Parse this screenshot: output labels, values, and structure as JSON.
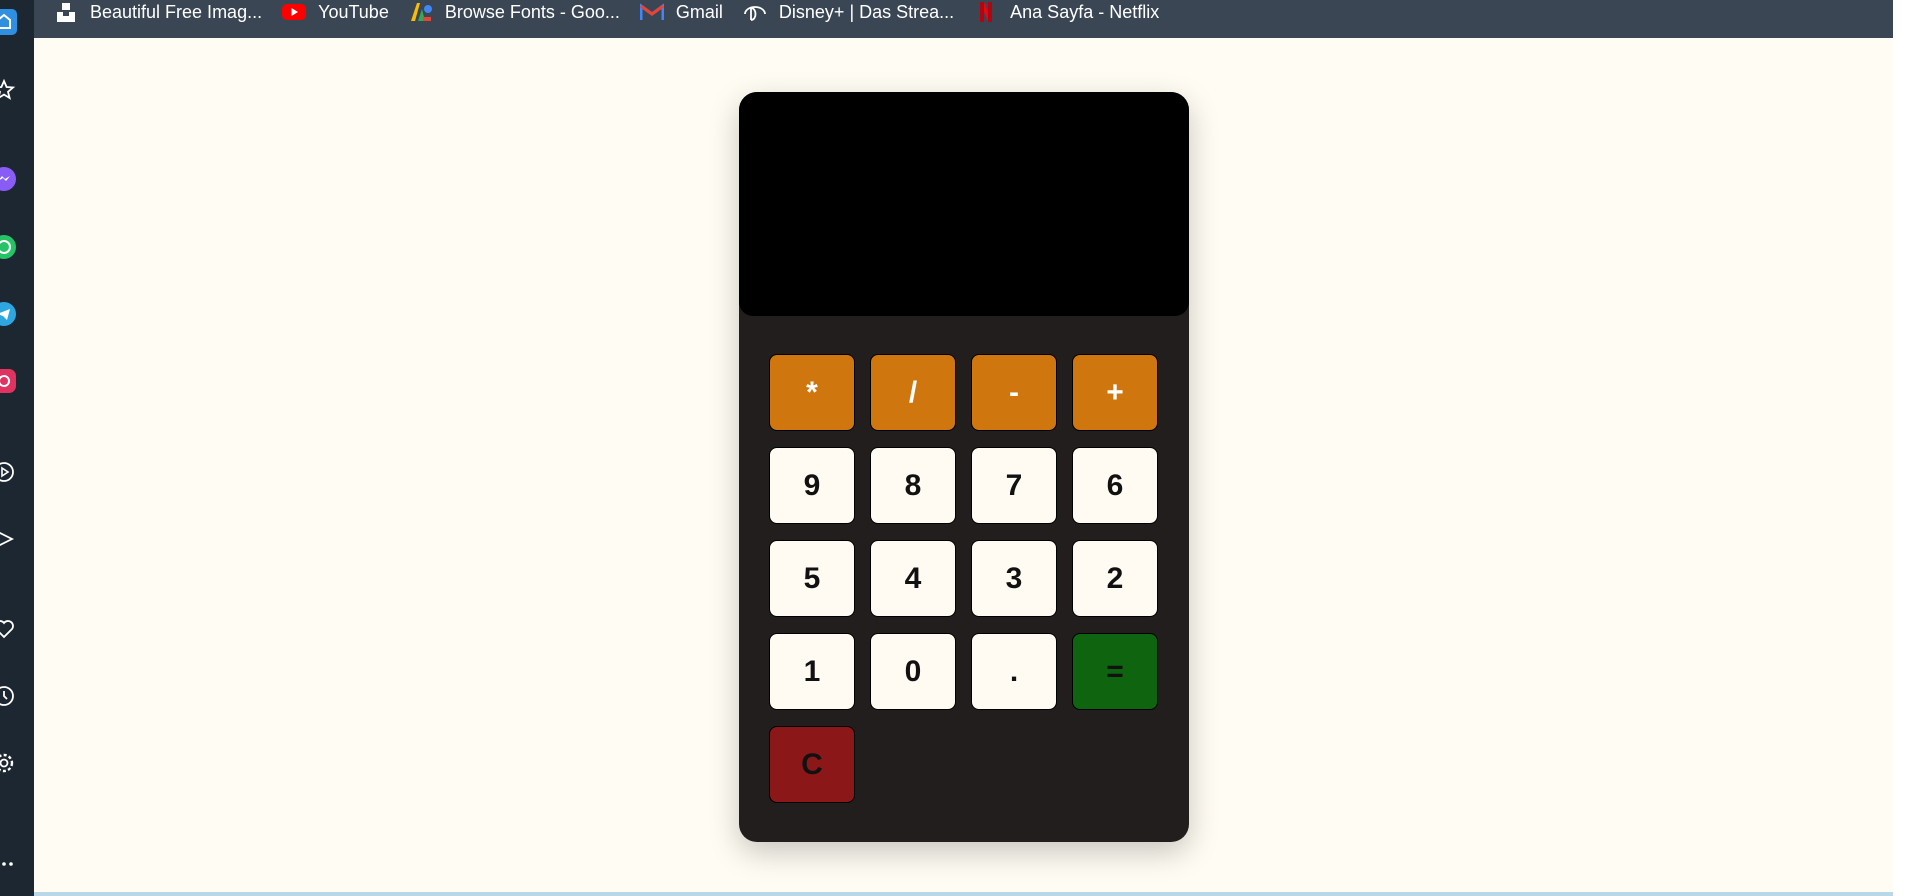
{
  "bookmarks": [
    {
      "label": "Beautiful Free Imag...",
      "icon": "unsplash-icon"
    },
    {
      "label": "YouTube",
      "icon": "youtube-icon"
    },
    {
      "label": "Browse Fonts - Goo...",
      "icon": "google-fonts-icon"
    },
    {
      "label": "Gmail",
      "icon": "gmail-icon"
    },
    {
      "label": "Disney+ | Das Strea...",
      "icon": "disney-plus-icon"
    },
    {
      "label": "Ana Sayfa - Netflix",
      "icon": "netflix-icon"
    }
  ],
  "sidebar_icons": [
    "home-icon",
    "bookmark-star-icon",
    "messenger-icon",
    "whatsapp-icon",
    "telegram-icon",
    "instagram-icon",
    "player-icon",
    "send-icon",
    "heart-icon",
    "history-icon",
    "settings-icon",
    "more-icon"
  ],
  "calculator": {
    "display_value": "",
    "keys": {
      "multiply": "*",
      "divide": "/",
      "subtract": "-",
      "add": "+",
      "nine": "9",
      "eight": "8",
      "seven": "7",
      "six": "6",
      "five": "5",
      "four": "4",
      "three": "3",
      "two": "2",
      "one": "1",
      "zero": "0",
      "decimal": ".",
      "equals": "=",
      "clear": "C"
    }
  },
  "colors": {
    "operator": "#cf760e",
    "number": "#fffbf2",
    "equals": "#0f6410",
    "clear": "#8c1719",
    "calculator_body": "#211e1d",
    "display": "#000000",
    "page_background": "#fffcf3",
    "bookmarks_bar": "#3a4654"
  }
}
